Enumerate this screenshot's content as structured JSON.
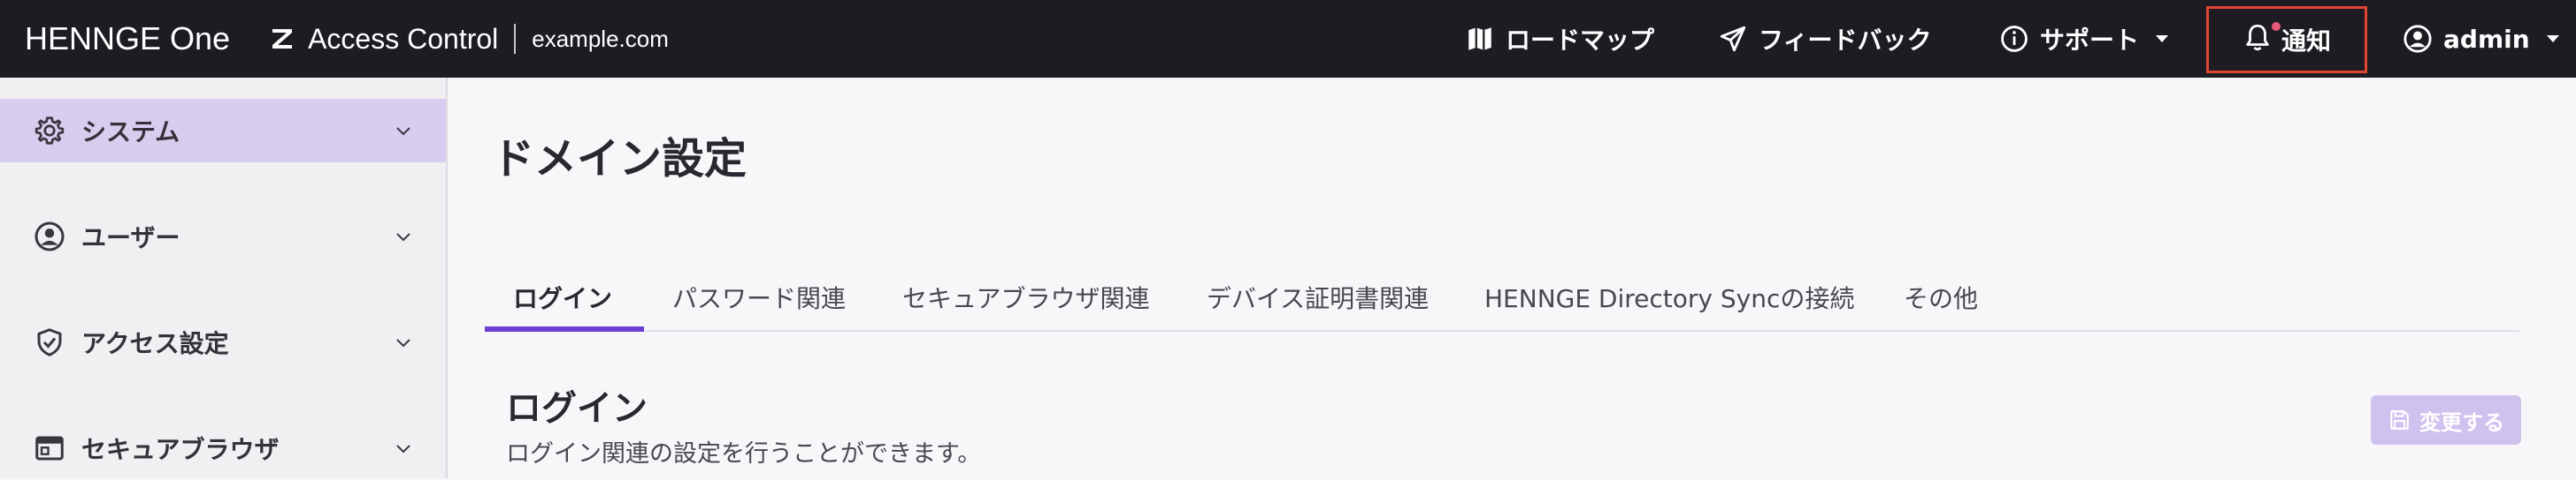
{
  "header": {
    "logo": "HENNGE One",
    "product_name": "Access Control",
    "domain": "example.com",
    "nav": {
      "roadmap": "ロードマップ",
      "feedback": "フィードバック",
      "support": "サポート",
      "notifications": "通知",
      "user": "admin"
    }
  },
  "sidebar": {
    "items": [
      {
        "label": "システム",
        "icon": "gear-icon",
        "active": true
      },
      {
        "label": "ユーザー",
        "icon": "user-circle-icon",
        "active": false
      },
      {
        "label": "アクセス設定",
        "icon": "shield-check-icon",
        "active": false
      },
      {
        "label": "セキュアブラウザ",
        "icon": "browser-window-icon",
        "active": false
      }
    ]
  },
  "main": {
    "page_title": "ドメイン設定",
    "tabs": [
      {
        "label": "ログイン",
        "active": true
      },
      {
        "label": "パスワード関連",
        "active": false
      },
      {
        "label": "セキュアブラウザ関連",
        "active": false
      },
      {
        "label": "デバイス証明書関連",
        "active": false
      },
      {
        "label": "HENNGE Directory Syncの接続",
        "active": false
      },
      {
        "label": "その他",
        "active": false
      }
    ],
    "section_title": "ログイン",
    "section_desc": "ログイン関連の設定を行うことができます。",
    "change_button": "変更する"
  },
  "colors": {
    "topbar_bg": "#1f1b22",
    "accent": "#6b3fd1",
    "sidebar_active": "#d8cdef",
    "notification_outline": "#e0452f",
    "button_disabled": "#cfc2ee"
  }
}
